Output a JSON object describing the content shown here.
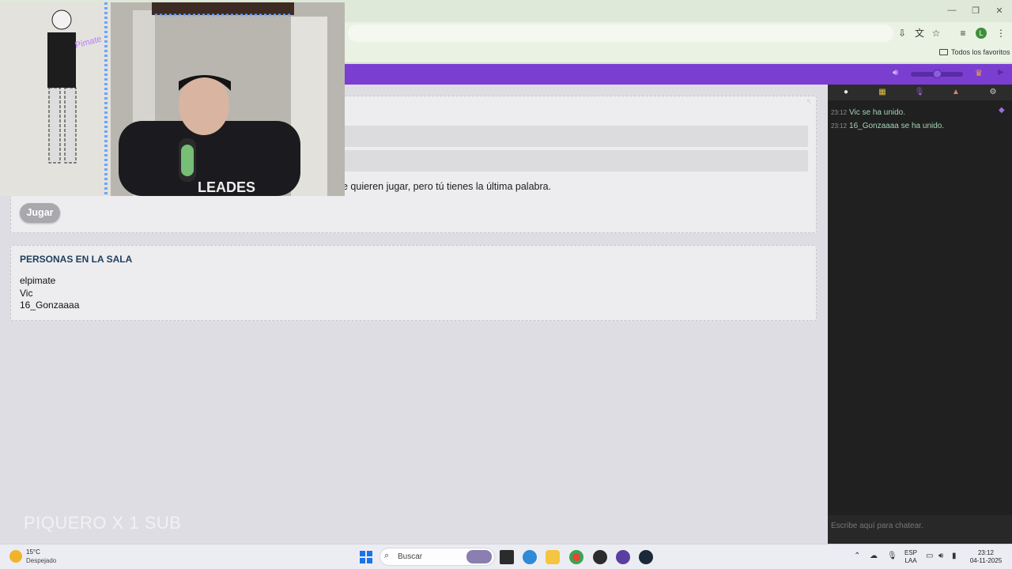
{
  "browser": {
    "bookmark_all": "Todos los favoritos",
    "profile_initial": "L"
  },
  "game": {
    "rule_text": "e quieren jugar, pero tú tienes la última palabra.",
    "play_button": "Jugar"
  },
  "room": {
    "title": "PERSONAS EN LA SALA",
    "people": [
      "elpimate",
      "Vic",
      "16_Gonzaaaa"
    ]
  },
  "overlay_text": "PIQUERO X 1 SUB",
  "chat": {
    "messages": [
      {
        "time": "23:12",
        "text": "Vic se ha unido."
      },
      {
        "time": "23:12",
        "text": "16_Gonzaaaa se ha unido."
      }
    ],
    "input_placeholder": "Escribe aquí para chatear."
  },
  "taskbar": {
    "weather_temp": "15°C",
    "weather_desc": "Despejado",
    "search_label": "Buscar",
    "lang_top": "ESP",
    "lang_bottom": "LAA",
    "clock_time": "23:12",
    "clock_date": "04-11-2025"
  },
  "colors": {
    "header_purple": "#7a3fd1",
    "chat_bg": "#202020",
    "chat_text": "#a6d3b5",
    "room_title": "#1f3d5a"
  }
}
